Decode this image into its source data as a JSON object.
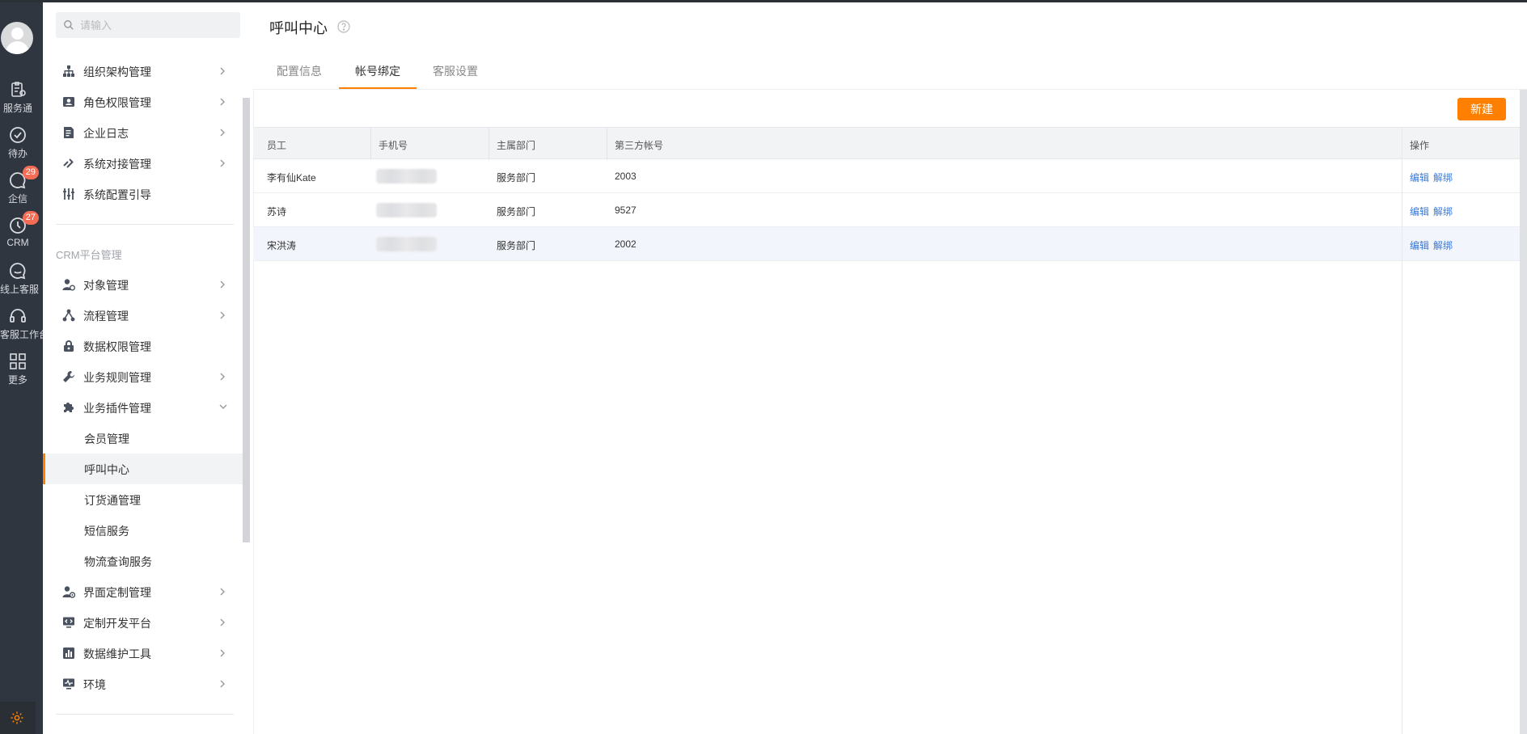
{
  "rail": {
    "items": [
      {
        "label": "服务通",
        "icon": "clipboard-icon"
      },
      {
        "label": "待办",
        "icon": "check-circle-icon"
      },
      {
        "label": "企信",
        "icon": "chat-bubble-icon",
        "badge": "29"
      },
      {
        "label": "CRM",
        "icon": "clock-icon",
        "badge": "27"
      },
      {
        "label": "线上客服",
        "icon": "smile-bubble-icon"
      },
      {
        "label": "客服工作台",
        "icon": "headset-icon"
      },
      {
        "label": "更多",
        "icon": "grid-icon"
      }
    ]
  },
  "sidebar": {
    "search_placeholder": "请输入",
    "group1": [
      {
        "label": "组织架构管理",
        "icon": "org-chart-icon"
      },
      {
        "label": "角色权限管理",
        "icon": "user-card-icon"
      },
      {
        "label": "企业日志",
        "icon": "document-icon"
      },
      {
        "label": "系统对接管理",
        "icon": "link-icon"
      },
      {
        "label": "系统配置引导",
        "icon": "sliders-icon"
      }
    ],
    "section_title": "CRM平台管理",
    "group2": [
      {
        "label": "对象管理",
        "icon": "user-gear-icon"
      },
      {
        "label": "流程管理",
        "icon": "flow-icon"
      },
      {
        "label": "数据权限管理",
        "icon": "lock-icon"
      },
      {
        "label": "业务规则管理",
        "icon": "wrench-icon"
      },
      {
        "label": "业务插件管理",
        "icon": "puzzle-icon"
      }
    ],
    "plugin_sub": [
      {
        "label": "会员管理"
      },
      {
        "label": "呼叫中心"
      },
      {
        "label": "订货通管理"
      },
      {
        "label": "短信服务"
      },
      {
        "label": "物流查询服务"
      }
    ],
    "group3": [
      {
        "label": "界面定制管理",
        "icon": "user-settings-icon"
      },
      {
        "label": "定制开发平台",
        "icon": "code-monitor-icon"
      },
      {
        "label": "数据维护工具",
        "icon": "bar-chart-icon"
      },
      {
        "label": "环境",
        "icon": "monitor-pulse-icon"
      }
    ]
  },
  "main": {
    "title": "呼叫中心",
    "tabs": [
      "配置信息",
      "帐号绑定",
      "客服设置"
    ],
    "active_tab": "帐号绑定",
    "new_button": "新建",
    "columns": [
      "员工",
      "手机号",
      "主属部门",
      "第三方帐号",
      "操作"
    ],
    "rows": [
      {
        "employee": "李有仙Kate",
        "dept": "服务部门",
        "account": "2003",
        "edit": "编辑",
        "unbind": "解绑"
      },
      {
        "employee": "苏诗",
        "dept": "服务部门",
        "account": "9527",
        "edit": "编辑",
        "unbind": "解绑"
      },
      {
        "employee": "宋洪涛",
        "dept": "服务部门",
        "account": "2002",
        "edit": "编辑",
        "unbind": "解绑"
      }
    ]
  },
  "colors": {
    "accent": "#ff8000",
    "link": "#3a78d6",
    "rail_bg": "#2f3640",
    "badge": "#f56c54"
  }
}
